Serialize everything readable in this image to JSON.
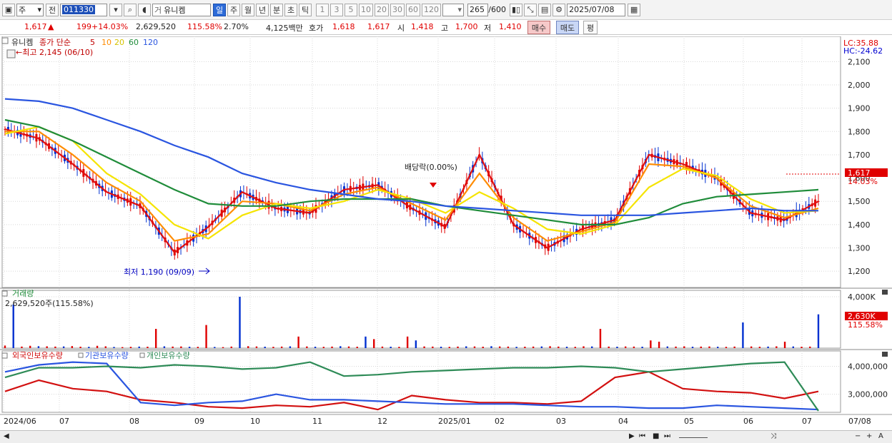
{
  "toolbar": {
    "type_select": "주",
    "prev_btn": "전",
    "stock_code": "011330",
    "stock_name": "유니켐",
    "period_tabs": [
      "일",
      "주",
      "월",
      "년",
      "분",
      "초",
      "틱"
    ],
    "interval_buttons": [
      "1",
      "3",
      "5",
      "10",
      "20",
      "30",
      "60",
      "120"
    ],
    "count": "265",
    "count_total": "/600",
    "date": "2025/07/08"
  },
  "quote": {
    "price": "1,617",
    "change": "199",
    "change_pct": "+14.03%",
    "volume": "2,629,520",
    "vol_ratio": "115.58%",
    "turnover": "2.70%",
    "amount": "4,125백만",
    "ask_label": "호가",
    "ask_price": "1,618",
    "bid_price": "1,617",
    "open_label": "시",
    "open": "1,418",
    "high_label": "고",
    "high": "1,700",
    "low_label": "저",
    "low": "1,410",
    "buy_btn": "매수",
    "sell_btn": "매도",
    "eval_btn": "평"
  },
  "price_panel": {
    "title": "유니켐",
    "series_label": "종가 단순",
    "ma_labels": [
      "5",
      "10",
      "20",
      "60",
      "120"
    ],
    "high_note": "←최고 2,145 (06/10)",
    "low_note": "최저 1,190 (09/09)",
    "dividend_note": "배당락(0.00%)",
    "lc": "LC:35.88",
    "hc": "HC:-24.62",
    "current_tag": "1,617",
    "current_pct": "14.03%"
  },
  "volume_panel": {
    "title": "거래량",
    "current": "2,629,520주(115.58%)",
    "tag": "2,630K",
    "tag_pct": "115.58%"
  },
  "holdings_panel": {
    "legend": [
      "외국인보유수량",
      "기관보유수량",
      "개인보유수량"
    ]
  },
  "x_axis_labels": [
    "2024/06",
    "07",
    "08",
    "09",
    "10",
    "11",
    "12",
    "2025/01",
    "02",
    "03",
    "04",
    "05",
    "06",
    "07",
    "07/08"
  ],
  "colors": {
    "ma5": "#e01010",
    "ma10": "#ff8c00",
    "ma20": "#f5e400",
    "ma60": "#1f8c3a",
    "ma120": "#2a55e0",
    "up": "#e00000",
    "down": "#0030d0",
    "foreign": "#d21010",
    "inst": "#2a55e0",
    "retail": "#2e8b57"
  },
  "chart_data": [
    {
      "type": "line",
      "title": "유니켐",
      "ylim": [
        1130,
        2190
      ],
      "yticks": [
        1200,
        1300,
        1400,
        1500,
        1600,
        1700,
        1800,
        1900,
        2000,
        2100
      ],
      "x": [
        "2024/06",
        "07",
        "08",
        "09",
        "10",
        "11",
        "12",
        "2025/01",
        "02",
        "03",
        "04",
        "05",
        "06",
        "07",
        "07/08"
      ],
      "series": [
        {
          "name": "5",
          "values": [
            1810,
            1770,
            1660,
            1540,
            1480,
            1280,
            1390,
            1540,
            1470,
            1450,
            1550,
            1570,
            1470,
            1390,
            1700,
            1400,
            1300,
            1380,
            1420,
            1700,
            1660,
            1600,
            1450,
            1420,
            1500
          ]
        },
        {
          "name": "10",
          "values": [
            1800,
            1800,
            1700,
            1580,
            1500,
            1330,
            1360,
            1500,
            1490,
            1460,
            1530,
            1560,
            1490,
            1420,
            1620,
            1430,
            1330,
            1370,
            1410,
            1660,
            1650,
            1600,
            1480,
            1430,
            1470
          ]
        },
        {
          "name": "20",
          "values": [
            1790,
            1820,
            1760,
            1620,
            1530,
            1400,
            1340,
            1440,
            1490,
            1470,
            1500,
            1550,
            1510,
            1450,
            1540,
            1470,
            1380,
            1360,
            1400,
            1560,
            1640,
            1610,
            1510,
            1450,
            1460
          ]
        },
        {
          "name": "60",
          "values": [
            1850,
            1820,
            1760,
            1690,
            1620,
            1550,
            1490,
            1480,
            1480,
            1500,
            1510,
            1510,
            1510,
            1480,
            1460,
            1440,
            1420,
            1400,
            1400,
            1430,
            1490,
            1520,
            1530,
            1540,
            1550
          ]
        },
        {
          "name": "120",
          "values": [
            1940,
            1930,
            1900,
            1850,
            1800,
            1740,
            1690,
            1620,
            1580,
            1550,
            1530,
            1510,
            1500,
            1480,
            1470,
            1460,
            1450,
            1440,
            1440,
            1440,
            1450,
            1460,
            1470,
            1460,
            1460
          ]
        }
      ],
      "annotations": [
        {
          "text": "최고",
          "value": 2145,
          "date": "06/10"
        },
        {
          "text": "최저",
          "value": 1190,
          "date": "09/09"
        },
        {
          "text": "배당락(0.00%)"
        }
      ],
      "current_value": 1617
    },
    {
      "type": "bar",
      "title": "거래량",
      "ylabel": "거래량",
      "yticks_labels": [
        "4,000K"
      ],
      "ylim": [
        0,
        4500
      ],
      "values_k": [
        200,
        3400,
        120,
        180,
        150,
        140,
        120,
        130,
        160,
        110,
        100,
        180,
        140,
        90,
        80,
        100,
        120,
        110,
        1500,
        140,
        120,
        130,
        110,
        100,
        1800,
        90,
        80,
        120,
        4000,
        150,
        130,
        110,
        100,
        120,
        140,
        900,
        130,
        110,
        100,
        120,
        150,
        130,
        110,
        900,
        700,
        120,
        110,
        100,
        900,
        600,
        130,
        120,
        110,
        100,
        120,
        140,
        130,
        110,
        150,
        130,
        120,
        100,
        110,
        120,
        130,
        150,
        120,
        110,
        100,
        140,
        130,
        1500,
        120,
        110,
        130,
        120,
        110,
        600,
        500,
        130,
        120,
        140,
        110,
        120,
        130,
        110,
        100,
        120,
        2000,
        130,
        110,
        120,
        140,
        500,
        130,
        110,
        120,
        2630
      ],
      "current_value_k": 2630
    },
    {
      "type": "line",
      "title": "보유수량",
      "yticks": [
        3000000,
        4000000
      ],
      "ylim": [
        2350000,
        4550000
      ],
      "series": [
        {
          "name": "외국인보유수량",
          "values": [
            3100000,
            3500000,
            3200000,
            3100000,
            2800000,
            2700000,
            2550000,
            2500000,
            2600000,
            2550000,
            2700000,
            2450000,
            2950000,
            2800000,
            2700000,
            2700000,
            2650000,
            2750000,
            3600000,
            3800000,
            3200000,
            3100000,
            3050000,
            2850000,
            3100000
          ]
        },
        {
          "name": "기관보유수량",
          "values": [
            3800000,
            4050000,
            4150000,
            4100000,
            2700000,
            2600000,
            2700000,
            2750000,
            3000000,
            2800000,
            2800000,
            2750000,
            2700000,
            2650000,
            2650000,
            2650000,
            2600000,
            2550000,
            2550000,
            2500000,
            2500000,
            2600000,
            2550000,
            2500000,
            2450000
          ]
        },
        {
          "name": "개인보유수량",
          "values": [
            3600000,
            3950000,
            3950000,
            4000000,
            3950000,
            4050000,
            4000000,
            3900000,
            3950000,
            4150000,
            3650000,
            3700000,
            3800000,
            3850000,
            3900000,
            3950000,
            3950000,
            4000000,
            3950000,
            3800000,
            3900000,
            4000000,
            4100000,
            4150000,
            2400000
          ]
        }
      ]
    }
  ]
}
